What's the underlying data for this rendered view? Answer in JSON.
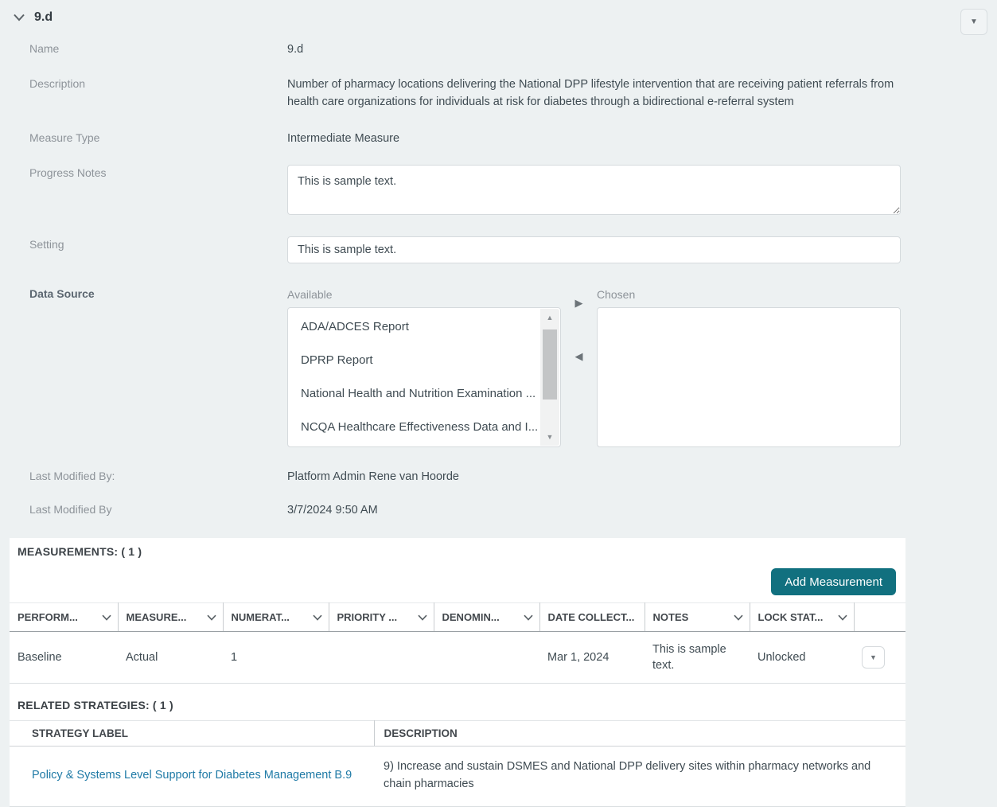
{
  "colors": {
    "page_background": "#edf1f2",
    "panel_background": "#ffffff",
    "accent_teal": "#11707f",
    "link_blue": "#1f7aa6",
    "label_gray": "#8d9399",
    "text_dark": "#3f4b52"
  },
  "icons": {
    "collapse_section": "▼",
    "row_menu": "▼",
    "scroll_up": "▲",
    "scroll_down": "▼",
    "move_right": "▶",
    "move_left": "◀"
  },
  "header": {
    "title": "9.d"
  },
  "form": {
    "name": {
      "label": "Name",
      "value": "9.d"
    },
    "description": {
      "label": "Description",
      "value": "Number of pharmacy locations delivering the National DPP lifestyle intervention that are receiving patient referrals from health care organizations for individuals at risk for diabetes through a bidirectional e-referral system"
    },
    "measure_type": {
      "label": "Measure Type",
      "value": "Intermediate Measure"
    },
    "progress_notes": {
      "label": "Progress Notes",
      "value": "This is sample text."
    },
    "setting": {
      "label": "Setting",
      "value": "This is sample text."
    },
    "data_source": {
      "label": "Data Source",
      "available_label": "Available",
      "chosen_label": "Chosen",
      "available_items": [
        "ADA/ADCES Report",
        "DPRP Report",
        "National Health and Nutrition Examination ...",
        "NCQA Healthcare Effectiveness Data and I..."
      ],
      "chosen_items": []
    },
    "last_modified_by_name": {
      "label": "Last Modified By:",
      "value": "Platform Admin Rene van Hoorde"
    },
    "last_modified_by_date": {
      "label": "Last Modified By",
      "value": "3/7/2024 9:50 AM"
    }
  },
  "measurements": {
    "heading": "MEASUREMENTS: ( 1 )",
    "add_button_label": "Add Measurement",
    "columns": [
      {
        "label": "PERFORM...",
        "sortable": true
      },
      {
        "label": "MEASURE...",
        "sortable": true
      },
      {
        "label": "NUMERAT...",
        "sortable": true
      },
      {
        "label": "PRIORITY ...",
        "sortable": true
      },
      {
        "label": "DENOMIN...",
        "sortable": true
      },
      {
        "label": "DATE COLLECT...",
        "sortable": false
      },
      {
        "label": "NOTES",
        "sortable": true
      },
      {
        "label": "LOCK STAT...",
        "sortable": true
      }
    ],
    "rows": [
      {
        "performance": "Baseline",
        "measure": "Actual",
        "numerator": "1",
        "priority": "",
        "denominator": "",
        "date_collected": "Mar 1, 2024",
        "notes": "This is sample text.",
        "lock_status": "Unlocked"
      }
    ]
  },
  "related_strategies": {
    "heading": "RELATED STRATEGIES: ( 1 )",
    "columns": {
      "label": "STRATEGY LABEL",
      "description": "DESCRIPTION"
    },
    "rows": [
      {
        "label": "Policy & Systems Level Support for Diabetes Management B.9",
        "description": "9) Increase and sustain DSMES and National DPP delivery sites within pharmacy networks and chain pharmacies"
      }
    ]
  }
}
